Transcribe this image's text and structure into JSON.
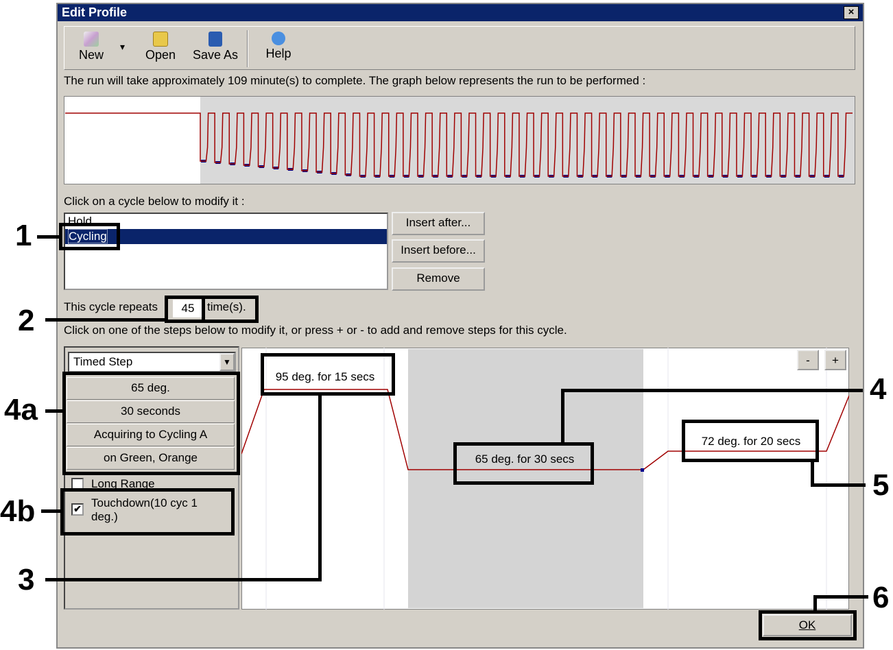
{
  "window": {
    "title": "Edit Profile",
    "close": "×"
  },
  "toolbar": {
    "new": "New",
    "open": "Open",
    "save_as": "Save As",
    "help": "Help",
    "dropdown": "▾"
  },
  "run_info": "The run will take approximately 109 minute(s) to complete. The graph below represents the run to be performed :",
  "run_graph": {
    "hold_count": 1,
    "cycles": 45,
    "line_color": "#a00000",
    "acquire_color": "#00008b"
  },
  "cycles_label": "Click on a cycle below to modify it :",
  "cycles": [
    {
      "label": "Hold",
      "selected": false
    },
    {
      "label": "Cycling",
      "selected": true
    }
  ],
  "cycle_buttons": {
    "insert_after": "Insert after...",
    "insert_before": "Insert before...",
    "remove": "Remove"
  },
  "repeats": {
    "prefix": "This cycle repeats",
    "value": "45",
    "suffix": "time(s)."
  },
  "steps_label": "Click on one of the steps below to modify it, or press + or - to add and remove steps for this cycle.",
  "step_editor": {
    "type": "Timed Step",
    "temperature": "65 deg.",
    "duration": "30 seconds",
    "acquiring": "Acquiring to Cycling A",
    "channels": "on Green, Orange",
    "long_range": {
      "label": "Long Range",
      "checked": false
    },
    "touchdown": {
      "label": "Touchdown(10 cyc 1 deg.)",
      "checked": true
    }
  },
  "steps": [
    {
      "label": "95 deg. for 15 secs"
    },
    {
      "label": "65 deg. for 30 secs"
    },
    {
      "label": "72 deg. for 20 secs"
    }
  ],
  "zoom": {
    "minus": "-",
    "plus": "+"
  },
  "ok": "OK",
  "annotations": [
    "1",
    "2",
    "3",
    "4",
    "4a",
    "4b",
    "5",
    "6"
  ]
}
